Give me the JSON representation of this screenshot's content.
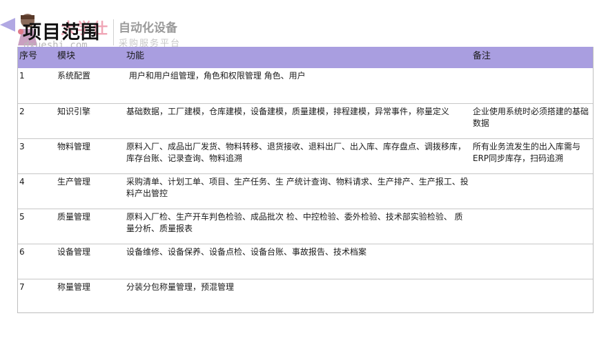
{
  "logo": {
    "brand": "大学仕",
    "domain": "dxueshi.com",
    "line1": "自动化设备",
    "line2": "采购服务平台"
  },
  "title": "项目范围",
  "table": {
    "headers": [
      "序号",
      "模块",
      "功能",
      "备注"
    ],
    "rows": [
      {
        "no": "1",
        "module": "系统配置",
        "function": " 用户和用户组管理，角色和权限管理 角色、用户",
        "note": ""
      },
      {
        "no": "2",
        "module": "知识引擎",
        "function": "基础数据，工厂建模，仓库建模，设备建模，质量建模，排程建模，异常事件，称量定义",
        "note": "企业使用系统时必须搭建的基础数据"
      },
      {
        "no": "3",
        "module": "物料管理",
        "function": "原料入厂、成品出厂发货、物料转移、退货接收、退料出厂、出入库、库存盘点、调拨移库，库存台账、记录查询、物料追溯",
        "note": "所有业务流发生的出入库需与ERP同步库存，扫码追溯"
      },
      {
        "no": "4",
        "module": "生产管理",
        "function": "采购清单、计划工单、项目、生产任务、生 产统计查询、物料请求、生产排产、生产报工、投料产出管控",
        "note": ""
      },
      {
        "no": "5",
        "module": "质量管理",
        "function": "原料入厂检、生产开车判色检验、成品批次 检、中控检验、委外检验、技术部实验检验、 质量分析、质量报表",
        "note": ""
      },
      {
        "no": "6",
        "module": "设备管理",
        "function": "设备维修、设备保养、设备点检、设备台账、事故报告、技术档案",
        "note": ""
      },
      {
        "no": "7",
        "module": "称量管理",
        "function": "分装分包称量管理，预混管理",
        "note": ""
      }
    ]
  }
}
